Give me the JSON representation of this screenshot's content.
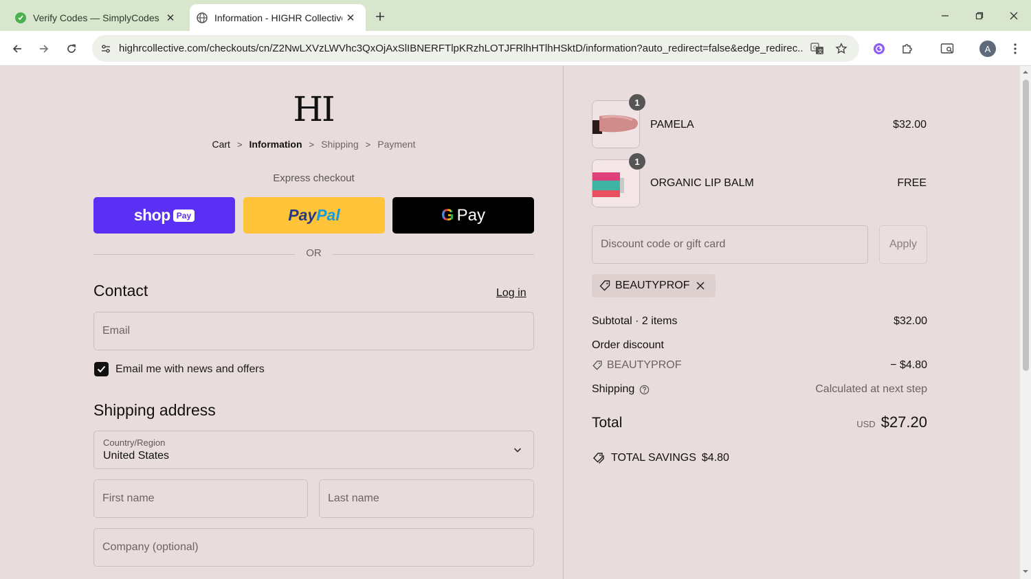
{
  "browser": {
    "tabs": [
      {
        "title": "Verify Codes — SimplyCodes",
        "active": false
      },
      {
        "title": "Information - HIGHR Collective",
        "active": true
      }
    ],
    "url": "highrcollective.com/checkouts/cn/Z2NwLXVzLWVhc3QxOjAxSlIBNERFTlpKRzhLOTJFRlhHTlhHSktD/information?auto_redirect=false&edge_redirec...",
    "profile_initial": "A"
  },
  "checkout": {
    "logo": "HI",
    "breadcrumbs": [
      "Cart",
      "Information",
      "Shipping",
      "Payment"
    ],
    "express_title": "Express checkout",
    "express": {
      "shop": "shop",
      "shop_pay": "Pay",
      "paypal_1": "Pay",
      "paypal_2": "Pal",
      "gpay_g": "G",
      "gpay": "Pay"
    },
    "or": "OR",
    "contact": {
      "title": "Contact",
      "login": "Log in",
      "email_placeholder": "Email",
      "newsletter_label": "Email me with news and offers",
      "newsletter_checked": true
    },
    "shipping": {
      "title": "Shipping address",
      "country_label": "Country/Region",
      "country_value": "United States",
      "first_name_placeholder": "First name",
      "last_name_placeholder": "Last name",
      "company_placeholder": "Company (optional)"
    }
  },
  "summary": {
    "items": [
      {
        "name": "PAMELA",
        "price": "$32.00",
        "qty": "1"
      },
      {
        "name": "ORGANIC LIP BALM",
        "price": "FREE",
        "qty": "1"
      }
    ],
    "discount_placeholder": "Discount code or gift card",
    "apply": "Apply",
    "applied_code": "BEAUTYPROF",
    "subtotal_label": "Subtotal · 2 items",
    "subtotal_value": "$32.00",
    "order_discount_label": "Order discount",
    "discount_code": "BEAUTYPROF",
    "discount_value": "− $4.80",
    "shipping_label": "Shipping",
    "shipping_value": "Calculated at next step",
    "total_label": "Total",
    "total_currency": "USD",
    "total_value": "$27.20",
    "savings_label": "TOTAL SAVINGS",
    "savings_value": "$4.80"
  }
}
